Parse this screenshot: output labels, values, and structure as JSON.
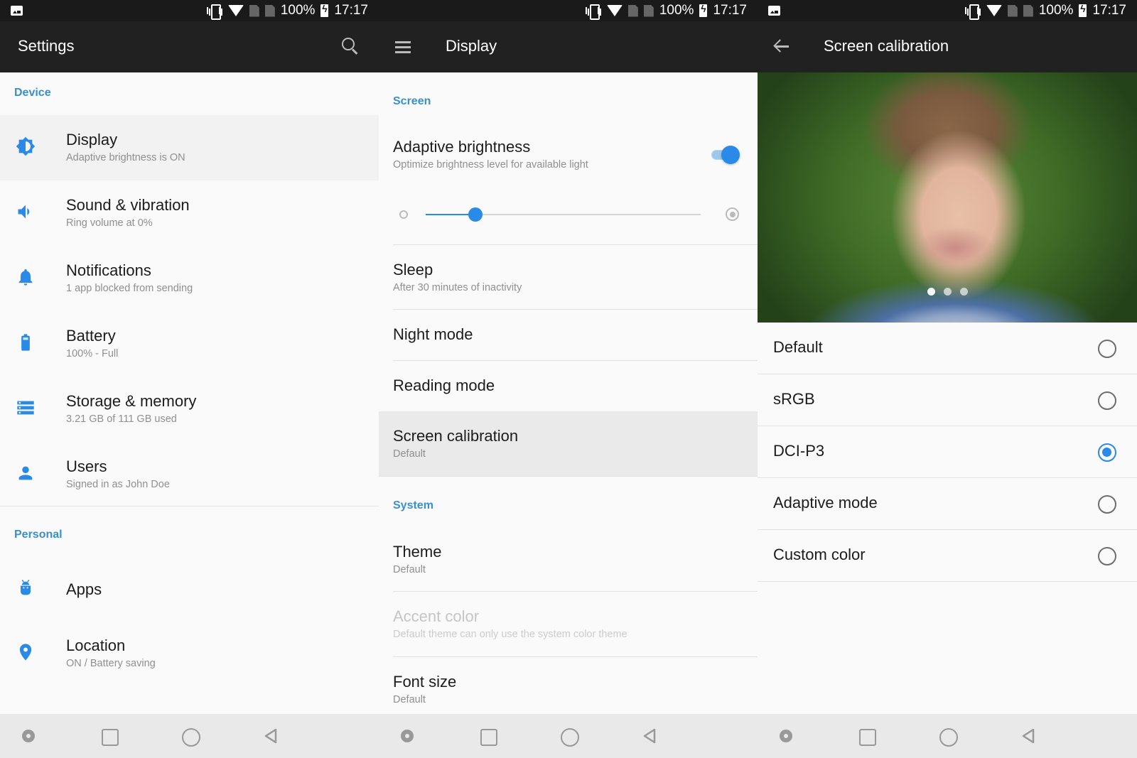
{
  "colors": {
    "accent": "#2a8ae8",
    "section_header": "#3a8fd0",
    "appbar": "#212121",
    "statusbar": "#1a1a1a",
    "background": "#fafafa",
    "navbar": "#e9e9e9"
  },
  "status_bar": {
    "battery_percent": "100%",
    "time": "17:17",
    "icons": [
      "vibrate-icon",
      "wifi-icon",
      "no-sim-icon",
      "no-sim-icon",
      "battery-charging-icon"
    ]
  },
  "nav_bar": {
    "buttons": [
      {
        "name": "assistant-dot",
        "icon": "dot-icon"
      },
      {
        "name": "recents",
        "icon": "square-icon"
      },
      {
        "name": "home",
        "icon": "circle-icon"
      },
      {
        "name": "back",
        "icon": "triangle-back-icon"
      }
    ]
  },
  "settings": {
    "title": "Settings",
    "search_icon": "search-icon",
    "sections": [
      {
        "header": "Device",
        "items": [
          {
            "title": "Display",
            "subtitle": "Adaptive brightness is ON",
            "icon": "brightness-icon",
            "highlighted": true
          },
          {
            "title": "Sound & vibration",
            "subtitle": "Ring volume at 0%",
            "icon": "volume-icon"
          },
          {
            "title": "Notifications",
            "subtitle": "1 app blocked from sending",
            "icon": "bell-icon"
          },
          {
            "title": "Battery",
            "subtitle": "100% - Full",
            "icon": "battery-icon"
          },
          {
            "title": "Storage & memory",
            "subtitle": "3.21 GB of 111 GB used",
            "icon": "storage-icon"
          },
          {
            "title": "Users",
            "subtitle": "Signed in as John Doe",
            "icon": "person-icon"
          }
        ]
      },
      {
        "header": "Personal",
        "items": [
          {
            "title": "Apps",
            "subtitle": "",
            "icon": "android-icon"
          },
          {
            "title": "Location",
            "subtitle": "ON / Battery saving",
            "icon": "location-pin-icon"
          }
        ]
      }
    ]
  },
  "display": {
    "title": "Display",
    "menu_icon": "hamburger-menu-icon",
    "screen_header": "Screen",
    "adaptive_brightness": {
      "title": "Adaptive brightness",
      "subtitle": "Optimize brightness level for available light",
      "enabled": true
    },
    "brightness_slider": {
      "value_percent": 18,
      "min_icon": "brightness-low-icon",
      "max_icon": "brightness-high-icon"
    },
    "screen_items": [
      {
        "title": "Sleep",
        "subtitle": "After 30 minutes of inactivity"
      },
      {
        "title": "Night mode",
        "subtitle": ""
      },
      {
        "title": "Reading mode",
        "subtitle": ""
      },
      {
        "title": "Screen calibration",
        "subtitle": "Default",
        "highlighted": true
      }
    ],
    "system_header": "System",
    "system_items": [
      {
        "title": "Theme",
        "subtitle": "Default"
      },
      {
        "title": "Accent color",
        "subtitle": "Default theme can only use the system color theme",
        "disabled": true
      },
      {
        "title": "Font size",
        "subtitle": "Default"
      }
    ]
  },
  "calibration": {
    "title": "Screen calibration",
    "back_icon": "arrow-back-icon",
    "preview_image": "smiling-boy-photo",
    "carousel": {
      "count": 3,
      "active_index": 0
    },
    "options": [
      {
        "label": "Default",
        "selected": false
      },
      {
        "label": "sRGB",
        "selected": false
      },
      {
        "label": "DCI-P3",
        "selected": true
      },
      {
        "label": "Adaptive mode",
        "selected": false
      },
      {
        "label": "Custom color",
        "selected": false
      }
    ]
  }
}
